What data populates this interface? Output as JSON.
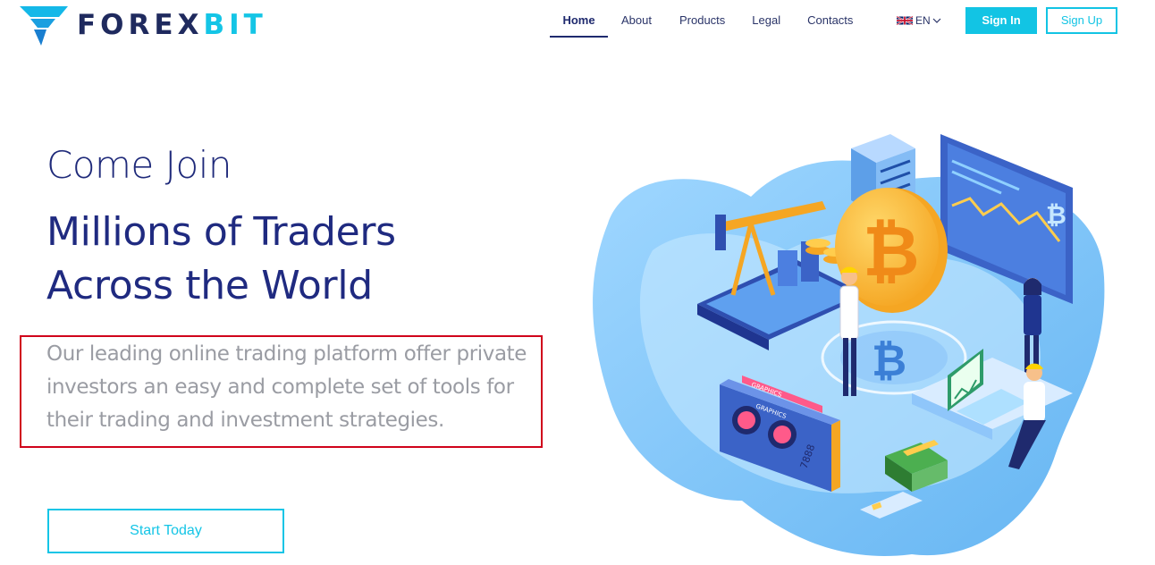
{
  "brand": {
    "name_part1": "FOREX",
    "name_part2": "BIT",
    "accent_color": "#14c5e6",
    "dark_color": "#1f2a5e"
  },
  "nav": {
    "items": [
      {
        "label": "Home",
        "active": true
      },
      {
        "label": "About",
        "active": false
      },
      {
        "label": "Products",
        "active": false
      },
      {
        "label": "Legal",
        "active": false
      },
      {
        "label": "Contacts",
        "active": false
      }
    ]
  },
  "language": {
    "selected": "EN",
    "flag_icon": "uk-flag-icon",
    "chevron_icon": "chevron-down-icon"
  },
  "auth": {
    "signin_label": "Sign In",
    "signup_label": "Sign Up"
  },
  "hero": {
    "kicker": "Come Join",
    "title_line1": "Millions of Traders",
    "title_line2": "Across the World",
    "description": "Our leading online trading platform offer private investors an easy and complete set of tools for their trading and investment strategies.",
    "cta_label": "Start Today"
  },
  "illustration": {
    "bitcoin_symbol": "₿",
    "card_labels": [
      "GRAPHICS",
      "GRAPHICS"
    ],
    "card_number": "7888"
  }
}
